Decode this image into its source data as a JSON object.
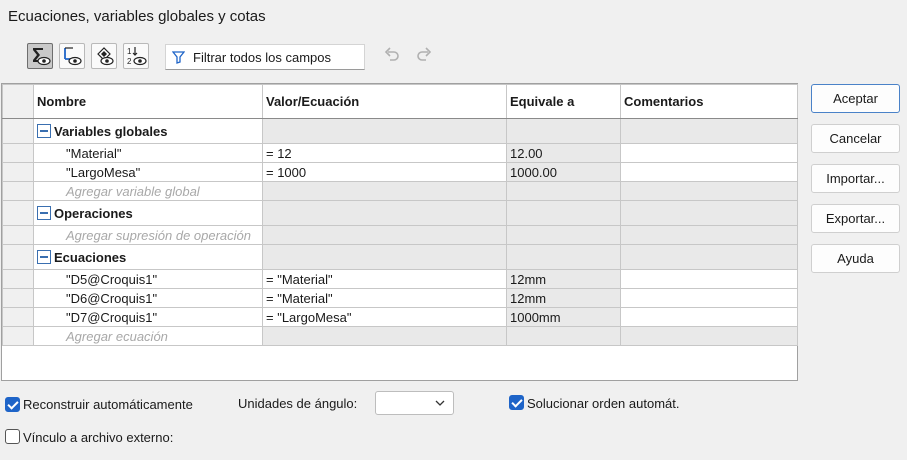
{
  "window": {
    "title": "Ecuaciones, variables globales y cotas"
  },
  "toolbar": {
    "buttons": [
      {
        "icon": "sigma-eye-icon",
        "active": true
      },
      {
        "icon": "dimension-eye-icon",
        "active": false
      },
      {
        "icon": "feature-eye-icon",
        "active": false
      },
      {
        "icon": "order-eye-icon",
        "active": false
      }
    ],
    "filter_placeholder": "Filtrar todos los campos"
  },
  "table": {
    "columns": [
      "Nombre",
      "Valor/Ecuación",
      "Equivale a",
      "Comentarios"
    ],
    "groups": [
      {
        "label": "Variables globales",
        "rows": [
          {
            "name": "\"Material\"",
            "value": "= 12",
            "equals": "12.00",
            "comment": ""
          },
          {
            "name": "\"LargoMesa\"",
            "value": "= 1000",
            "equals": "1000.00",
            "comment": ""
          }
        ],
        "add_label": "Agregar variable global"
      },
      {
        "label": "Operaciones",
        "rows": [],
        "add_label": "Agregar supresión de operación"
      },
      {
        "label": "Ecuaciones",
        "rows": [
          {
            "name": "\"D5@Croquis1\"",
            "value": "= \"Material\"",
            "equals": "12mm",
            "comment": ""
          },
          {
            "name": "\"D6@Croquis1\"",
            "value": "= \"Material\"",
            "equals": "12mm",
            "comment": ""
          },
          {
            "name": "\"D7@Croquis1\"",
            "value": "= \"LargoMesa\"",
            "equals": "1000mm",
            "comment": ""
          }
        ],
        "add_label": "Agregar ecuación"
      }
    ]
  },
  "buttons": {
    "accept": "Aceptar",
    "cancel": "Cancelar",
    "import": "Importar...",
    "export": "Exportar...",
    "help": "Ayuda"
  },
  "footer": {
    "auto_rebuild": {
      "label": "Reconstruir automáticamente",
      "checked": true
    },
    "angle_units_label": "Unidades de ángulo:",
    "angle_units_value": "",
    "auto_solve": {
      "label": "Solucionar orden automát.",
      "checked": true
    },
    "external_link": {
      "label": "Vínculo a archivo externo:",
      "checked": false
    }
  },
  "colors": {
    "accent": "#1e64c8",
    "primary_border": "#4a82c8"
  }
}
